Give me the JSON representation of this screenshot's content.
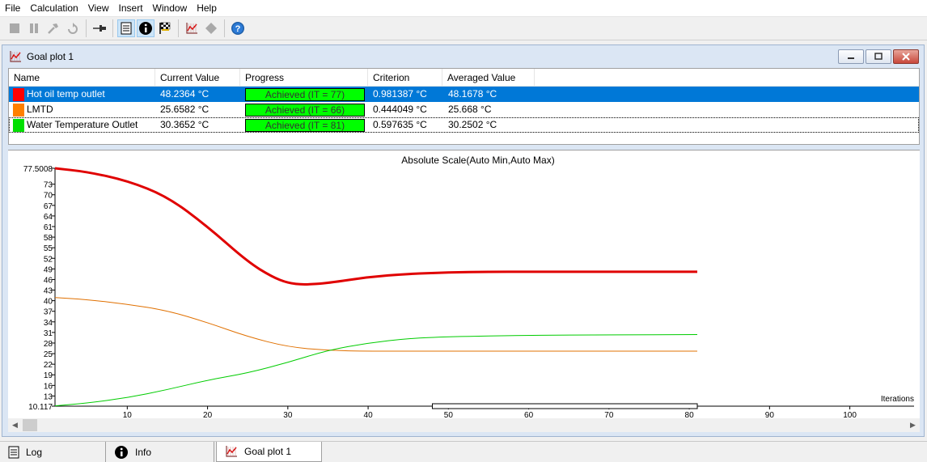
{
  "menu": [
    "File",
    "Calculation",
    "View",
    "Insert",
    "Window",
    "Help"
  ],
  "toolbar": {
    "buttons": [
      "stop-icon",
      "pause-icon",
      "hammer-icon",
      "reset-icon",
      "pin-icon",
      "document-icon",
      "info-icon",
      "checkered-flag-icon",
      "goal-plot-icon",
      "diamond-icon",
      "help-icon"
    ]
  },
  "window": {
    "title": "Goal plot 1"
  },
  "goals": {
    "columns": [
      "Name",
      "Current Value",
      "Progress",
      "Criterion",
      "Averaged Value"
    ],
    "rows": [
      {
        "color": "#ff0000",
        "name": "Hot oil temp outlet",
        "current": "48.2364 °C",
        "progress": "Achieved (IT = 77)",
        "criterion": "0.981387 °C",
        "averaged": "48.1678 °C"
      },
      {
        "color": "#ff8000",
        "name": "LMTD",
        "current": "25.6582 °C",
        "progress": "Achieved (IT = 66)",
        "criterion": "0.444049 °C",
        "averaged": "25.668 °C"
      },
      {
        "color": "#00e000",
        "name": "Water Temperature Outlet",
        "current": "30.3652 °C",
        "progress": "Achieved (IT = 81)",
        "criterion": "0.597635 °C",
        "averaged": "30.2502 °C"
      }
    ]
  },
  "chart_data": {
    "type": "line",
    "title": "Absolute Scale(Auto Min,Auto Max)",
    "xlabel": "Iterations",
    "ylabel": "",
    "xlim": [
      1,
      108
    ],
    "ylim": [
      10.117,
      77.5008
    ],
    "x_ticks": [
      10,
      20,
      30,
      40,
      50,
      60,
      70,
      80,
      90,
      100
    ],
    "y_ticks": [
      10.117,
      13,
      16,
      19,
      22,
      25,
      28,
      31,
      34,
      37,
      40,
      43,
      46,
      49,
      52,
      55,
      58,
      61,
      64,
      67,
      70,
      73,
      77.5008
    ],
    "y_tick_labels": [
      "10.117",
      "13",
      "16",
      "19",
      "22",
      "25",
      "28",
      "31",
      "34",
      "37",
      "40",
      "43",
      "46",
      "49",
      "52",
      "55",
      "58",
      "61",
      "64",
      "67",
      "70",
      "73",
      "77.5008"
    ],
    "range_marker": [
      48,
      81
    ],
    "series": [
      {
        "name": "Hot oil temp outlet",
        "color": "#e00000",
        "width": 3,
        "x": [
          1,
          5,
          10,
          15,
          20,
          25,
          28,
          30,
          32,
          35,
          40,
          45,
          50,
          55,
          60,
          70,
          81
        ],
        "y": [
          77.5,
          76.5,
          74.0,
          69.5,
          61.0,
          51.0,
          46.8,
          45.0,
          44.5,
          45.0,
          46.7,
          47.6,
          48.0,
          48.2,
          48.2,
          48.2,
          48.2
        ]
      },
      {
        "name": "LMTD",
        "color": "#e07000",
        "width": 1,
        "x": [
          1,
          5,
          10,
          15,
          20,
          25,
          30,
          35,
          40,
          50,
          60,
          81
        ],
        "y": [
          40.9,
          40.3,
          39.0,
          37.2,
          33.8,
          29.8,
          26.9,
          25.9,
          25.7,
          25.7,
          25.7,
          25.7
        ]
      },
      {
        "name": "Water Temperature Outlet",
        "color": "#00cc00",
        "width": 1,
        "x": [
          1,
          5,
          10,
          15,
          20,
          25,
          30,
          35,
          40,
          45,
          50,
          60,
          70,
          81
        ],
        "y": [
          10.2,
          11.0,
          12.5,
          14.8,
          17.5,
          19.5,
          22.5,
          26.0,
          28.0,
          29.3,
          29.8,
          30.2,
          30.3,
          30.4
        ]
      }
    ]
  },
  "tabs": [
    {
      "label": "Log",
      "icon": "document-icon"
    },
    {
      "label": "Info",
      "icon": "info-icon"
    },
    {
      "label": "Goal plot 1",
      "icon": "goal-plot-icon"
    }
  ]
}
